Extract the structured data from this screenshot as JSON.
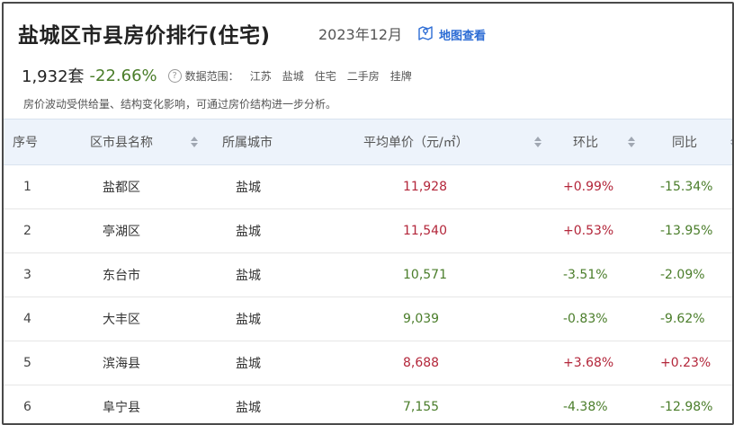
{
  "header": {
    "title": "盐城区市县房价排行(住宅)",
    "date": "2023年12月",
    "map_link": "地图查看"
  },
  "summary": {
    "count": "1,932套",
    "change": "-22.66%",
    "help_icon": "?",
    "scope_label": "数据范围：",
    "scope_tags": [
      "江苏",
      "盐城",
      "住宅",
      "二手房",
      "挂牌"
    ],
    "description": "房价波动受供给量、结构变化影响，可通过房价结构进一步分析。"
  },
  "table": {
    "columns": {
      "index": "序号",
      "name": "区市县名称",
      "city": "所属城市",
      "price": "平均单价（元/㎡）",
      "mom": "环比",
      "yoy": "同比"
    },
    "rows": [
      {
        "index": "1",
        "name": "盐都区",
        "city": "盐城",
        "price": "11,928",
        "mom": "+0.99%",
        "yoy": "-15.34%"
      },
      {
        "index": "2",
        "name": "亭湖区",
        "city": "盐城",
        "price": "11,540",
        "mom": "+0.53%",
        "yoy": "-13.95%"
      },
      {
        "index": "3",
        "name": "东台市",
        "city": "盐城",
        "price": "10,571",
        "mom": "-3.51%",
        "yoy": "-2.09%"
      },
      {
        "index": "4",
        "name": "大丰区",
        "city": "盐城",
        "price": "9,039",
        "mom": "-0.83%",
        "yoy": "-9.62%"
      },
      {
        "index": "5",
        "name": "滨海县",
        "city": "盐城",
        "price": "8,688",
        "mom": "+3.68%",
        "yoy": "+0.23%"
      },
      {
        "index": "6",
        "name": "阜宁县",
        "city": "盐城",
        "price": "7,155",
        "mom": "-4.38%",
        "yoy": "-12.98%"
      }
    ]
  },
  "colors": {
    "up": "#b3263a",
    "down": "#4a7d2a",
    "link": "#2b6bd4",
    "header_bg": "#edf3fb"
  }
}
